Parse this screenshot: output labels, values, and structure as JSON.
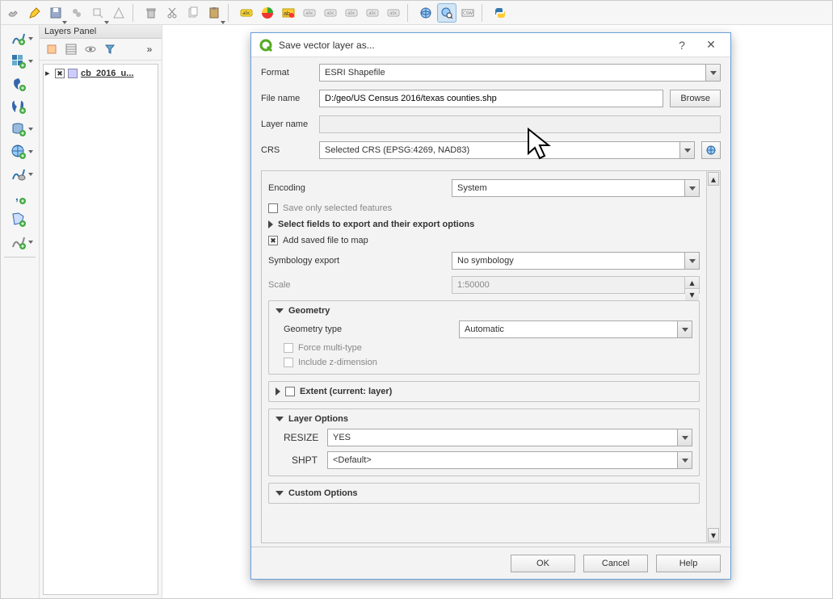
{
  "layers_panel": {
    "title": "Layers Panel",
    "layer_name": "cb_2016_u..."
  },
  "dialog": {
    "title": "Save vector layer as...",
    "labels": {
      "format": "Format",
      "filename": "File name",
      "layername": "Layer name",
      "crs": "CRS",
      "browse": "Browse",
      "encoding": "Encoding",
      "save_selected": "Save only selected features",
      "select_fields": "Select fields to export and their export options",
      "add_saved": "Add saved file to map",
      "symbology_export": "Symbology export",
      "scale": "Scale",
      "geometry": "Geometry",
      "geometry_type": "Geometry type",
      "force_multi": "Force multi-type",
      "include_z": "Include z-dimension",
      "extent": "Extent (current: layer)",
      "layer_options": "Layer Options",
      "resize": "RESIZE",
      "shpt": "SHPT",
      "custom_options": "Custom Options"
    },
    "values": {
      "format": "ESRI Shapefile",
      "filename": "D:/geo/US Census 2016/texas counties.shp",
      "layername": "",
      "crs": "Selected CRS (EPSG:4269, NAD83)",
      "encoding": "System",
      "symbology_export": "No symbology",
      "scale": "1:50000",
      "geometry_type": "Automatic",
      "resize": "YES",
      "shpt": "<Default>"
    },
    "buttons": {
      "ok": "OK",
      "cancel": "Cancel",
      "help": "Help"
    }
  }
}
